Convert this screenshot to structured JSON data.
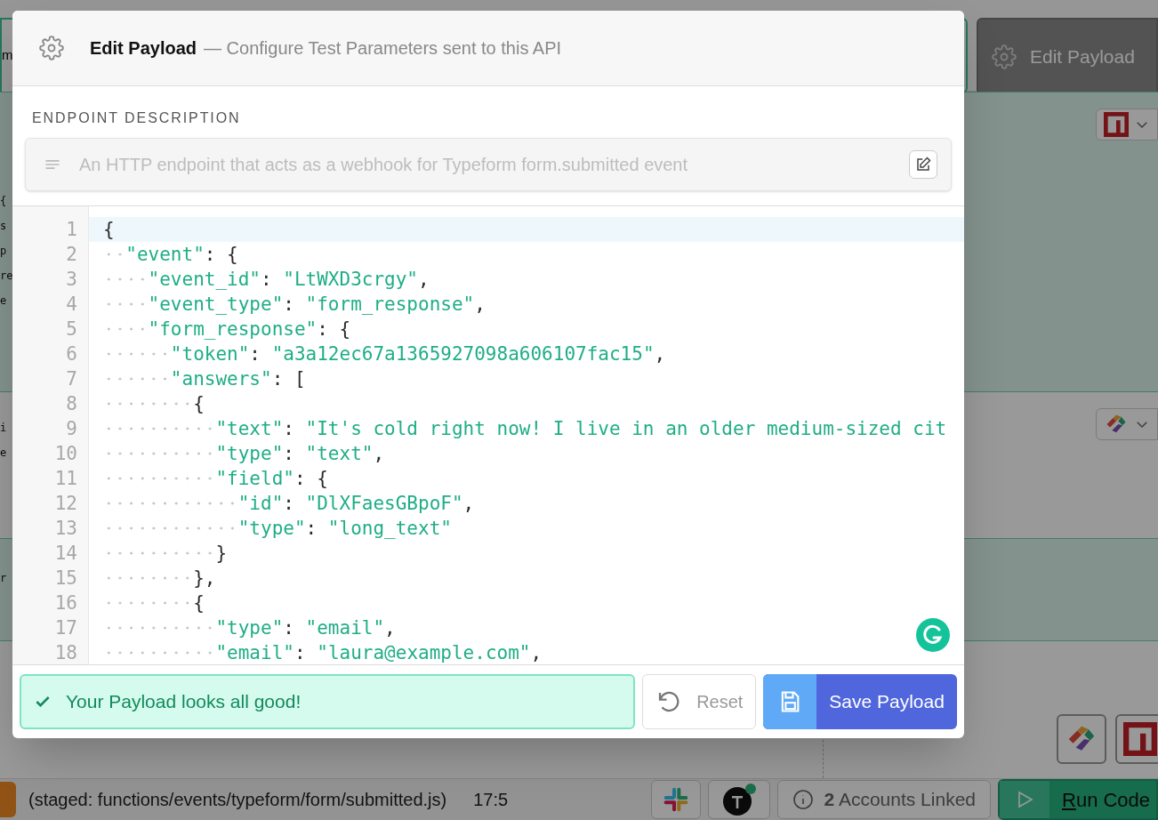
{
  "background": {
    "top_field_fragment": "m",
    "top_button": "Edit Payload",
    "sections": [
      {
        "highlighted": true,
        "fragments": [
          "{",
          "s",
          "p",
          "re",
          "e"
        ],
        "logo": {
          "kind": "square"
        }
      },
      {
        "highlighted": false,
        "fragments": [
          "i",
          "e"
        ],
        "logo": {
          "kind": "ring"
        }
      },
      {
        "highlighted": true,
        "fragments": [
          "r"
        ]
      },
      {
        "highlighted": false,
        "logos": [
          {
            "kind": "ring"
          },
          {
            "kind": "square"
          }
        ]
      }
    ],
    "status_bar": {
      "staged": "(staged: functions/events/typeform/form/submitted.js)",
      "position": "17:5",
      "accounts": "**2** Accounts Linked",
      "run": "Run Code"
    }
  },
  "modal": {
    "title": "Edit Payload",
    "subtitle": "— Configure Test Parameters sent to this API",
    "section_label": "ENDPOINT DESCRIPTION",
    "description": "An HTTP endpoint that acts as a webhook for Typeform form.submitted event",
    "lines": [
      {
        "number": "1",
        "text": "{",
        "active": true
      },
      {
        "number": "2",
        "text": "  \"event\": {",
        "active": false
      },
      {
        "number": "3",
        "text": "    \"event_id\": \"LtWXD3crgy\",",
        "active": false
      },
      {
        "number": "4",
        "text": "    \"event_type\": \"form_response\",",
        "active": false
      },
      {
        "number": "5",
        "text": "    \"form_response\": {",
        "active": false
      },
      {
        "number": "6",
        "text": "      \"token\": \"a3a12ec67a1365927098a606107fac15\",",
        "active": false
      },
      {
        "number": "7",
        "text": "      \"answers\": [",
        "active": false
      },
      {
        "number": "8",
        "text": "        {",
        "active": false
      },
      {
        "number": "9",
        "text": "          \"text\": \"It's cold right now! I live in an older medium-sized cit",
        "active": false
      },
      {
        "number": "10",
        "text": "          \"type\": \"text\",",
        "active": false
      },
      {
        "number": "11",
        "text": "          \"field\": {",
        "active": false
      },
      {
        "number": "12",
        "text": "            \"id\": \"DlXFaesGBpoF\",",
        "active": false
      },
      {
        "number": "13",
        "text": "            \"type\": \"long_text\"",
        "active": false
      },
      {
        "number": "14",
        "text": "          }",
        "active": false
      },
      {
        "number": "15",
        "text": "        },",
        "active": false
      },
      {
        "number": "16",
        "text": "        {",
        "active": false
      },
      {
        "number": "17",
        "text": "          \"type\": \"email\",",
        "active": false
      },
      {
        "number": "18",
        "text": "          \"email\": \"laura@example.com\",",
        "active": false
      }
    ],
    "status": "Your Payload looks all good!",
    "reset": "Reset",
    "save": "Save Payload"
  }
}
